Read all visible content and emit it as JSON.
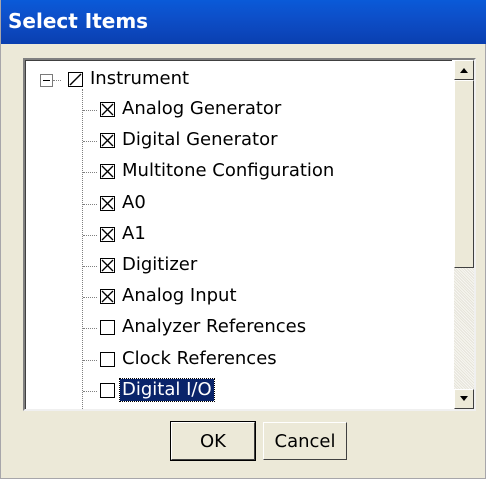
{
  "window": {
    "title": "Select Items"
  },
  "tree": {
    "root": {
      "label": "Instrument",
      "state": "partial",
      "expanded": true
    },
    "items": [
      {
        "label": "Analog Generator",
        "checked": true,
        "selected": false
      },
      {
        "label": "Digital Generator",
        "checked": true,
        "selected": false
      },
      {
        "label": "Multitone Configuration",
        "checked": true,
        "selected": false
      },
      {
        "label": "A0",
        "checked": true,
        "selected": false
      },
      {
        "label": "A1",
        "checked": true,
        "selected": false
      },
      {
        "label": "Digitizer",
        "checked": true,
        "selected": false
      },
      {
        "label": "Analog Input",
        "checked": true,
        "selected": false
      },
      {
        "label": "Analyzer References",
        "checked": false,
        "selected": false
      },
      {
        "label": "Clock References",
        "checked": false,
        "selected": false
      },
      {
        "label": "Digital I/O",
        "checked": false,
        "selected": true
      }
    ]
  },
  "buttons": {
    "ok_label": "OK",
    "cancel_label": "Cancel"
  },
  "colors": {
    "titlebar": "#0a4fc9",
    "selection": "#0a246a",
    "dialog_bg": "#ece9d8"
  }
}
